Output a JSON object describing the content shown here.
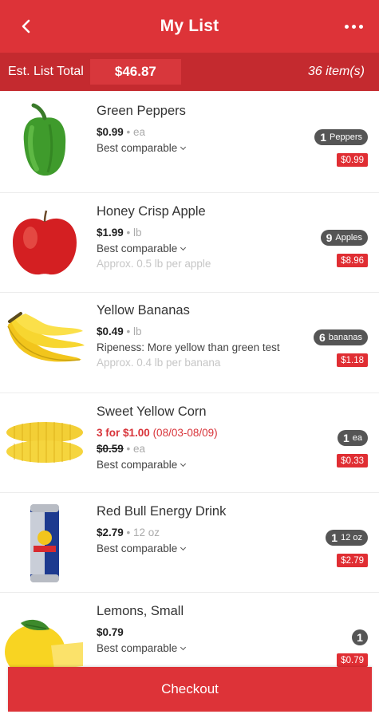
{
  "header": {
    "title": "My List",
    "back_icon": "back-chevron-icon",
    "more_icon": "more-dots-icon"
  },
  "summary": {
    "label": "Est. List Total",
    "total": "$46.87",
    "count": "36 item(s)"
  },
  "items": [
    {
      "name": "Green Peppers",
      "price": "$0.99",
      "unit": "ea",
      "line2": "Best comparable",
      "qty": "1",
      "qty_unit": "Peppers",
      "line_total": "$0.99",
      "image": "green-pepper-image"
    },
    {
      "name": "Honey Crisp Apple",
      "price": "$1.99",
      "unit": "lb",
      "line2": "Best comparable",
      "approx": "Approx. 0.5 lb per apple",
      "qty": "9",
      "qty_unit": "Apples",
      "line_total": "$8.96",
      "image": "apple-image"
    },
    {
      "name": "Yellow Bananas",
      "price": "$0.49",
      "unit": "lb",
      "line2": "Ripeness: More yellow than green test",
      "approx": "Approx. 0.4 lb per banana",
      "qty": "6",
      "qty_unit": "bananas",
      "line_total": "$1.18",
      "image": "bananas-image"
    },
    {
      "name": "Sweet Yellow Corn",
      "promo": "3 for $1.00",
      "promo_dates": "(08/03-08/09)",
      "price": "$0.59",
      "unit": "ea",
      "line2": "Best comparable",
      "qty": "1",
      "qty_unit": "ea",
      "line_total": "$0.33",
      "image": "corn-image"
    },
    {
      "name": "Red Bull Energy Drink",
      "price": "$2.79",
      "unit": "12 oz",
      "line2": "Best comparable",
      "qty": "1",
      "qty_unit": "12 oz",
      "line_total": "$2.79",
      "image": "energy-drink-can-image"
    },
    {
      "name": "Lemons, Small",
      "price": "$0.79",
      "line2": "Best comparable",
      "qty": "1",
      "line_total": "$0.79",
      "image": "lemon-image"
    }
  ],
  "checkout": {
    "label": "Checkout"
  },
  "colors": {
    "brand_red": "#dd3338",
    "dark_red": "#c42a2f",
    "badge": "#555555"
  }
}
